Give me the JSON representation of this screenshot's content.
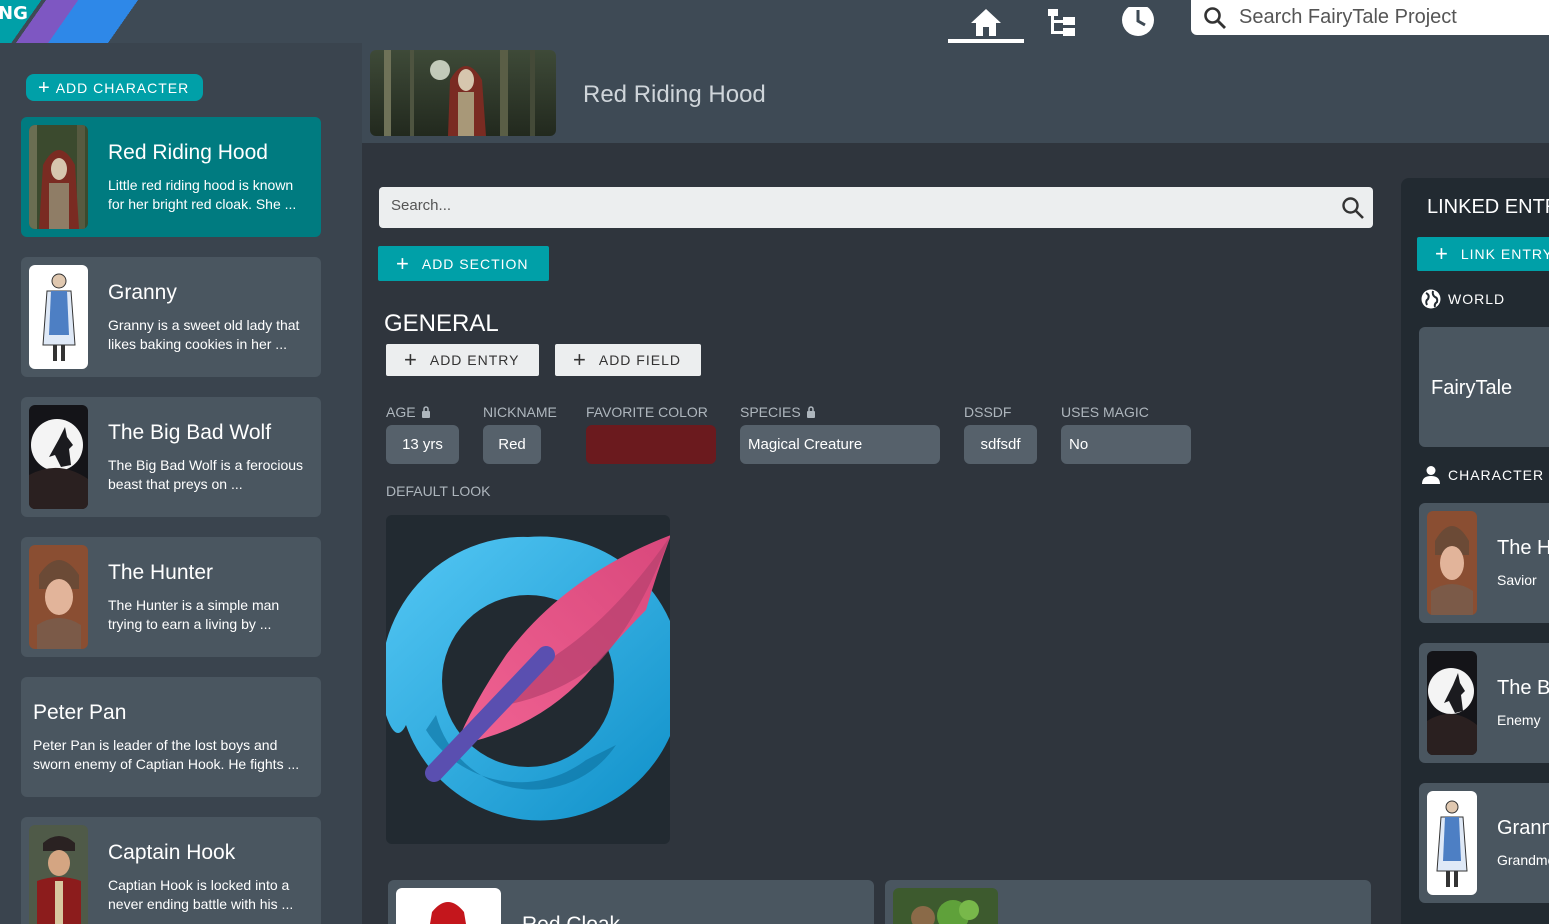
{
  "app": {
    "brand_text": "NG"
  },
  "topbar": {
    "nav": [
      {
        "name": "home",
        "icon": "home-icon",
        "active": true
      },
      {
        "name": "tree",
        "icon": "tree-structure-icon",
        "active": false
      },
      {
        "name": "history",
        "icon": "clock-icon",
        "active": false
      }
    ],
    "search_placeholder": "Search FairyTale Project"
  },
  "sidebar": {
    "add_label": "ADD CHARACTER",
    "characters": [
      {
        "title": "Red Riding Hood",
        "desc": "Little red riding hood is known for her bright red cloak. She ...",
        "active": true
      },
      {
        "title": "Granny",
        "desc": "Granny is a sweet old lady that likes baking cookies in her ..."
      },
      {
        "title": "The Big Bad Wolf",
        "desc": "The Big Bad Wolf is a ferocious beast that preys on ..."
      },
      {
        "title": "The Hunter",
        "desc": "The Hunter is a simple man trying to earn a living by ..."
      },
      {
        "title": "Peter Pan",
        "desc": "Peter Pan is leader of the lost boys and sworn enemy of Captian Hook. He fights ..."
      },
      {
        "title": "Captain Hook",
        "desc": "Captian Hook is locked into a never ending battle with his ..."
      }
    ]
  },
  "header": {
    "title": "Red Riding Hood"
  },
  "main": {
    "search_placeholder": "Search...",
    "add_section_label": "ADD SECTION",
    "section_title": "GENERAL",
    "add_entry_label": "ADD ENTRY",
    "add_field_label": "ADD FIELD",
    "fields": [
      {
        "label": "AGE",
        "value": "13 yrs",
        "locked": true
      },
      {
        "label": "NICKNAME",
        "value": "Red",
        "locked": false
      },
      {
        "label": "FAVORITE COLOR",
        "value": "",
        "color": "#6b1a1e",
        "locked": false
      },
      {
        "label": "SPECIES",
        "value": "Magical Creature",
        "locked": true
      },
      {
        "label": "DSSDF",
        "value": "sdfsdf",
        "locked": false
      },
      {
        "label": "USES MAGIC",
        "value": "No",
        "locked": false
      }
    ],
    "default_look_label": "DEFAULT LOOK",
    "items": [
      {
        "title": "Red Cloak"
      },
      {
        "title": ""
      }
    ]
  },
  "linked": {
    "title": "LINKED ENTRIES",
    "link_label": "LINK ENTRY",
    "world_group": "WORLD",
    "world_entry": "FairyTale",
    "character_group": "CHARACTER",
    "characters": [
      {
        "title": "The Hunter",
        "sub": "Savior"
      },
      {
        "title": "The Big Bad Wolf",
        "sub": "Enemy"
      },
      {
        "title": "Granny",
        "sub": "Grandmother"
      }
    ]
  },
  "colors": {
    "accent": "#00a0a8",
    "panel": "#3a444e",
    "card": "#4a5660",
    "active_card": "#007b80"
  }
}
